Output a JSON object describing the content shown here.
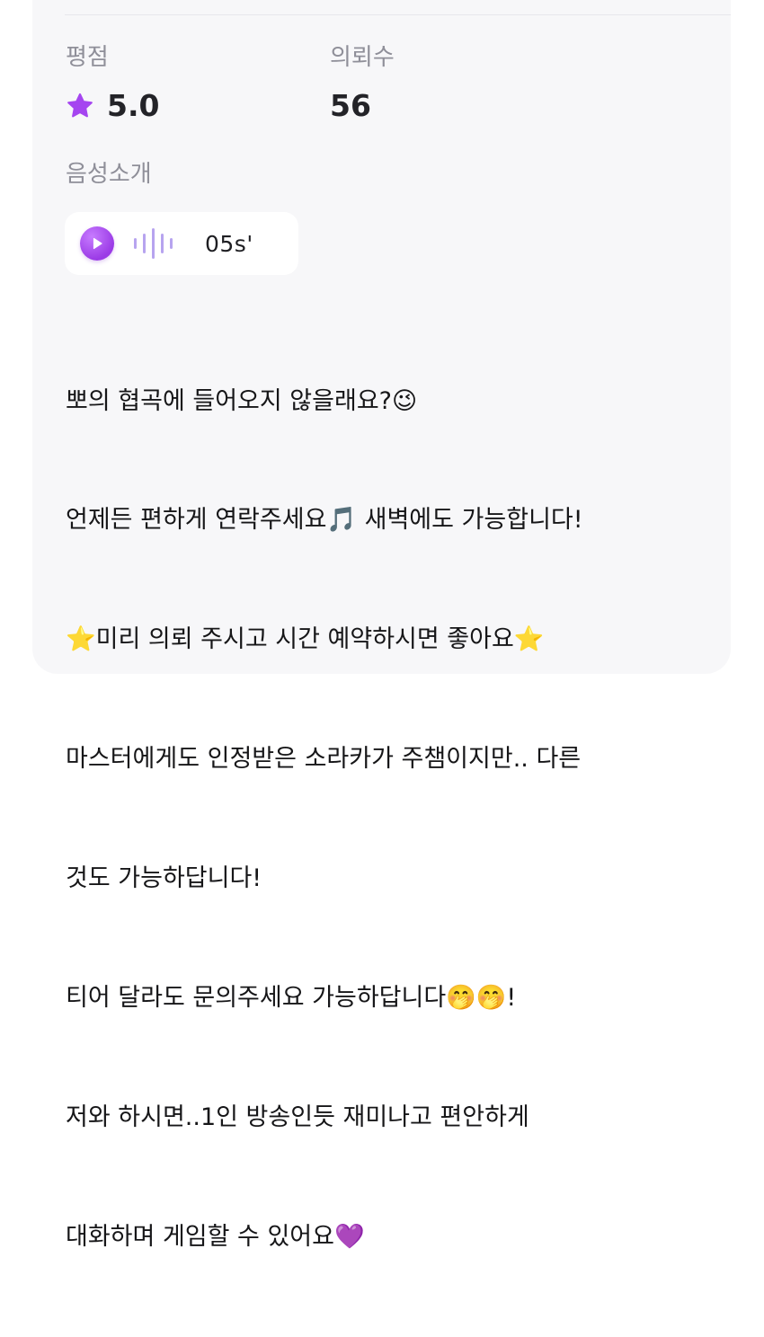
{
  "stats": {
    "rating_label": "평점",
    "rating_value": "5.0",
    "requests_label": "의뢰수",
    "requests_value": "56"
  },
  "voice_intro": {
    "label": "음성소개",
    "duration": "05s'"
  },
  "icons": {
    "rating": "star-icon",
    "play": "play-icon",
    "audio": "waveform-icon"
  },
  "colors": {
    "accent_purple": "#a545f0",
    "label_gray": "#8f8f99",
    "card_background": "#f7f7f9"
  },
  "description": {
    "lines": [
      "뽀의 협곡에 들어오지 않을래요?😉",
      "언제든 편하게 연락주세요🎵 새벽에도 가능합니다!",
      "⭐미리 의뢰 주시고 시간 예약하시면 좋아요⭐",
      "마스터에게도 인정받은 소라카가 주챔이지만.. 다른",
      "것도 가능하답니다!",
      "티어 달라도 문의주세요 가능하답니다🤭🤭!",
      "저와 하시면..1인 방송인듯 재미나고 편안하게",
      "대화하며 게임할 수 있어요💜"
    ]
  }
}
